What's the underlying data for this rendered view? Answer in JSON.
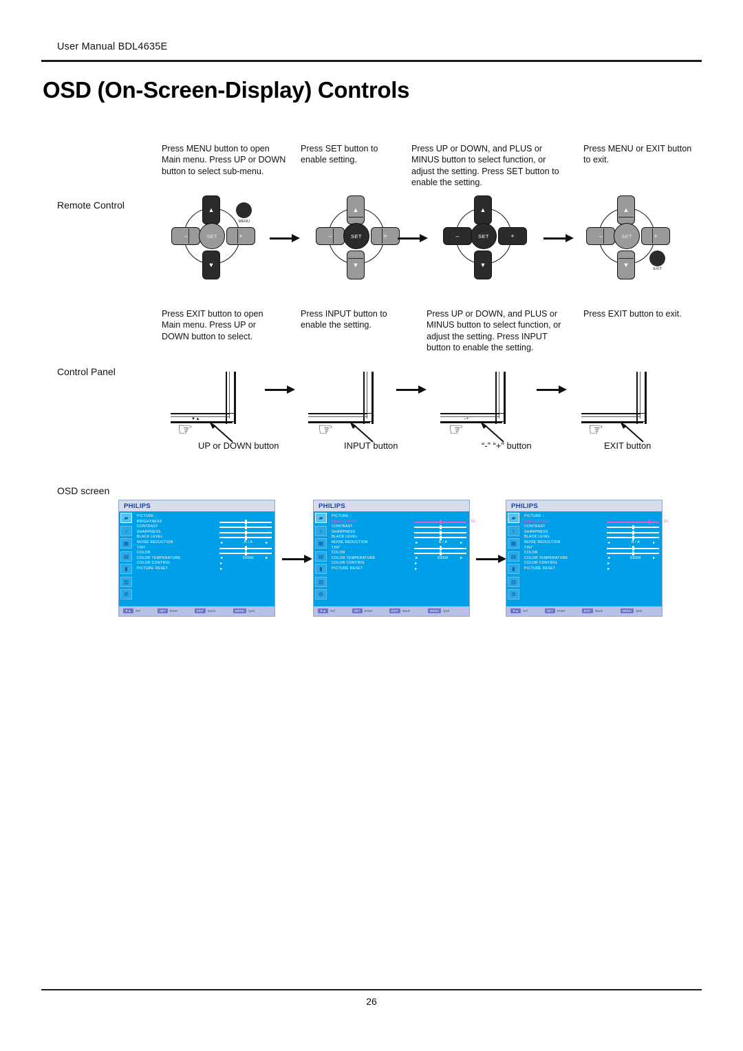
{
  "header": {
    "manual_line": "User Manual BDL4635E",
    "title": "OSD (On-Screen-Display) Controls"
  },
  "row_labels": {
    "remote": "Remote Control",
    "panel": "Control Panel",
    "osd": "OSD screen"
  },
  "remote_steps": [
    "Press MENU button to open Main menu.   Press UP or DOWN button to select sub-menu.",
    "Press SET button to enable setting.",
    "Press UP or DOWN, and PLUS or MINUS button to select function, or adjust the setting. Press SET button to enable the setting.",
    "Press MENU or EXIT button to exit."
  ],
  "panel_steps": [
    "Press EXIT button to open Main menu. Press UP or DOWN button to select.",
    "Press INPUT button to enable the setting.",
    "Press UP or DOWN, and PLUS or MINUS button to select function, or adjust the setting. Press INPUT button to enable the setting.",
    "Press EXIT button to exit."
  ],
  "remote_buttons": {
    "up": "▲",
    "down": "▼",
    "minus": "–",
    "plus": "+",
    "set": "SET",
    "menu": "MENU",
    "exit": "EXIT"
  },
  "panel_captions": [
    "UP or DOWN button",
    "INPUT button",
    "“-” “+” button",
    "EXIT button"
  ],
  "panel_keyglyphs": [
    "▼▲",
    "",
    "–+",
    ""
  ],
  "osd": {
    "logo": "PHILIPS",
    "sidebar_icons": [
      "picture-icon",
      "audio-icon",
      "pip-icon",
      "configuration1-icon",
      "configuration2-icon",
      "advanced-option-icon",
      "tools-icon"
    ],
    "sidebar_glyphs": [
      "▰",
      "♪",
      "▦",
      "▤",
      "▮",
      "▥",
      "⚙"
    ],
    "menu_title": "PICTURE :",
    "rows": [
      {
        "label": "BRIGHTNESS",
        "kind": "slider",
        "value": "50",
        "pos": 50
      },
      {
        "label": "CONTRAST",
        "kind": "slider",
        "value": "50",
        "pos": 50
      },
      {
        "label": "SHARPNESS",
        "kind": "slider",
        "value": "50",
        "pos": 50
      },
      {
        "label": "BLACK  LEVEL",
        "kind": "slider",
        "value": "50",
        "pos": 50
      },
      {
        "label": "NOISE  REDUCTION",
        "kind": "option",
        "value": "N / A"
      },
      {
        "label": "TINT",
        "kind": "slider",
        "value": "50",
        "pos": 50
      },
      {
        "label": "COLOR",
        "kind": "slider",
        "value": "50",
        "pos": 50
      },
      {
        "label": "COLOR TEMPERATURE",
        "kind": "option",
        "value": "9300K"
      },
      {
        "label": "COLOR CONTROL",
        "kind": "sub",
        "value": ""
      },
      {
        "label": "PICTURE  RESET",
        "kind": "sub",
        "value": ""
      }
    ],
    "brightness_adjusted_value": "82",
    "footer": [
      {
        "key": "▼▲",
        "text": "Sel"
      },
      {
        "key": "SET",
        "text": "Enter"
      },
      {
        "key": "EXIT",
        "text": "Back"
      },
      {
        "key": "MENU",
        "text": "Quit"
      }
    ],
    "colors": {
      "screen_bg": "#00a0e9",
      "header_bg": "#d7dced",
      "logo": "#17409a",
      "footer_bg": "#b9c0e4",
      "highlight": "#e85ad0"
    }
  },
  "footer": {
    "page_number": "26"
  }
}
